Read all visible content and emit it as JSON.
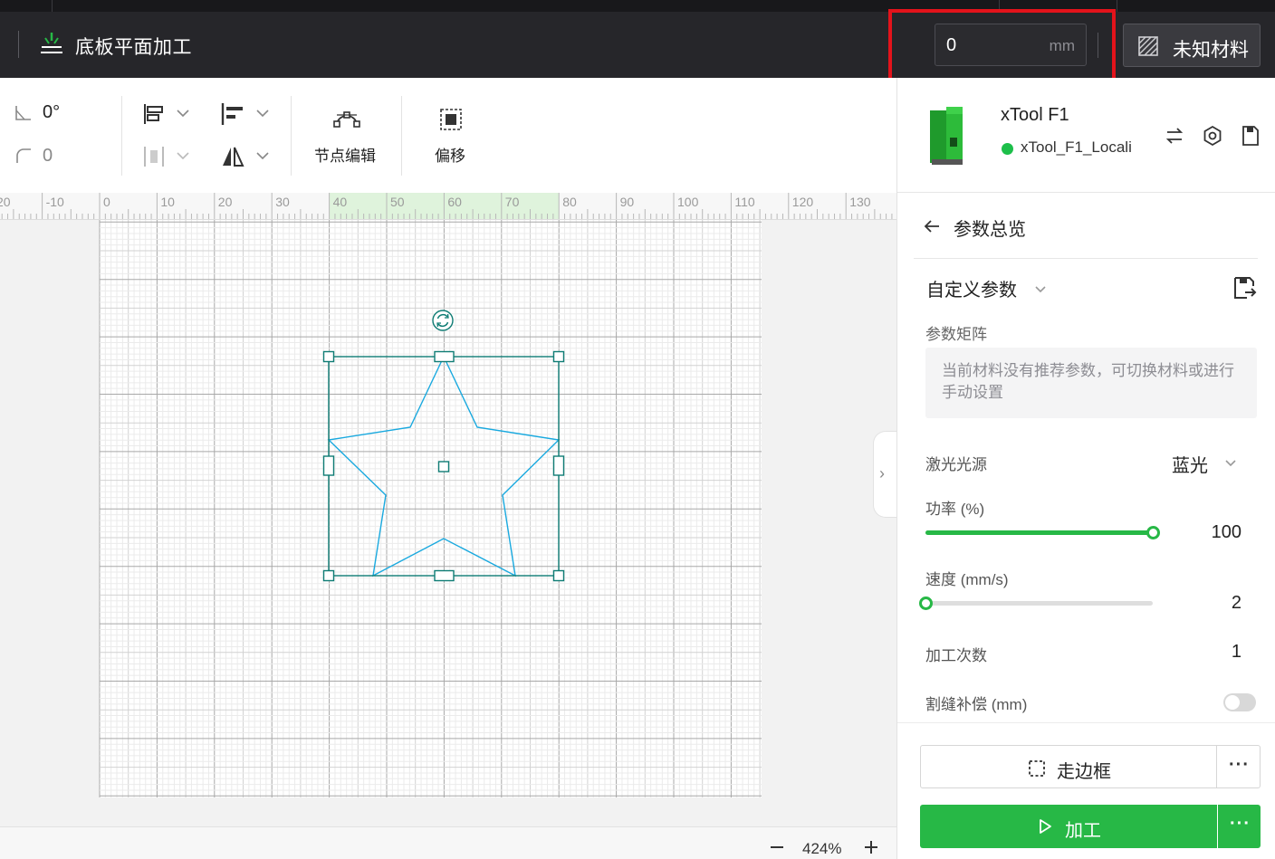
{
  "header": {
    "mode_title": "底板平面加工",
    "mode_icon": "laser-plane-icon",
    "thickness_value": "0",
    "thickness_unit": "mm",
    "material_label": "未知材料",
    "material_icon": "hatched-material-icon"
  },
  "toolbar": {
    "rotation_value": "0°",
    "corner_radius_value": "0",
    "node_edit_label": "节点编辑",
    "offset_label": "偏移"
  },
  "ruler": {
    "ticks": [
      "20",
      "-10",
      "0",
      "10",
      "20",
      "30",
      "40",
      "50",
      "60",
      "70",
      "80",
      "90",
      "100",
      "110",
      "120",
      "130"
    ]
  },
  "canvas": {
    "shape": "star",
    "colors": {
      "stroke": "#19a9df",
      "selection": "#0e7c74"
    }
  },
  "zoom": {
    "value": "424%"
  },
  "device": {
    "name": "xTool F1",
    "connection": "xTool_F1_Locali",
    "status_color": "#1dbf4a"
  },
  "params": {
    "title": "参数总览",
    "preset": "自定义参数",
    "matrix_label": "参数矩阵",
    "matrix_message": "当前材料没有推荐参数，可切换材料或进行手动设置",
    "laser_label": "激光光源",
    "laser_value": "蓝光",
    "power_label": "功率 (%)",
    "power_value": "100",
    "power_fraction": 1.0,
    "speed_label": "速度 (mm/s)",
    "speed_value": "2",
    "speed_fraction": 0.0,
    "passes_label": "加工次数",
    "passes_value": "1",
    "kerf_label": "割缝补偿 (mm)",
    "kerf_enabled": false
  },
  "actions": {
    "frame_label": "走边框",
    "process_label": "加工",
    "more": "···"
  },
  "accent": "#27b846"
}
